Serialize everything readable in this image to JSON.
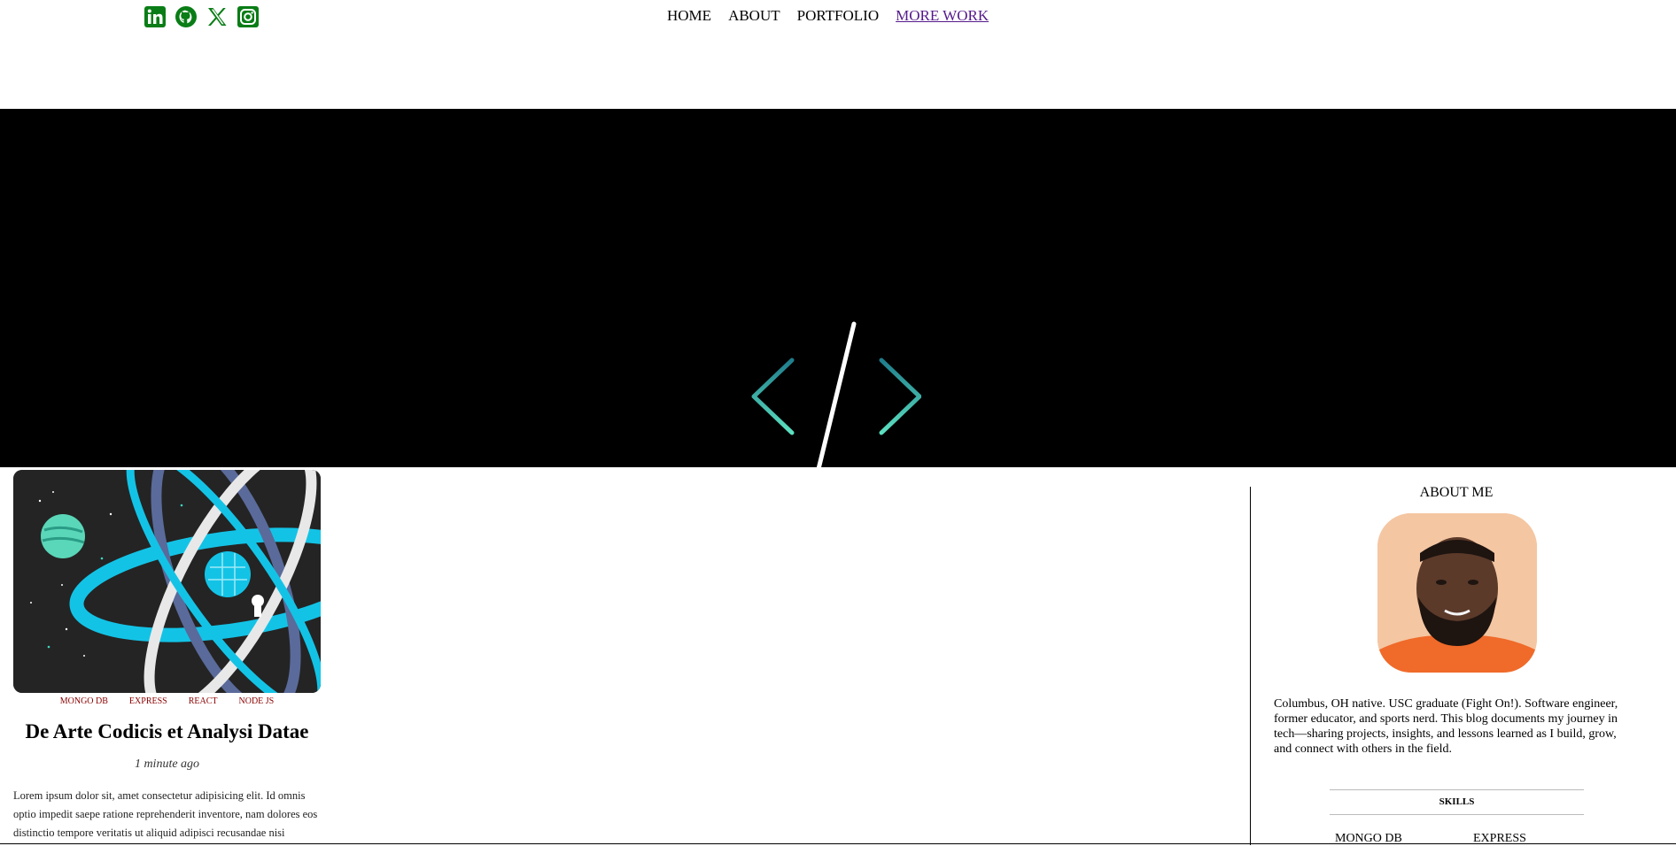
{
  "social": {
    "icons": [
      "linkedin-icon",
      "github-icon",
      "x-icon",
      "instagram-icon"
    ],
    "color": "#0a7d16"
  },
  "nav": {
    "items": [
      "HOME",
      "ABOUT",
      "PORTFOLIO",
      "MORE WORK"
    ]
  },
  "hero": {
    "icon": "code-slash-icon",
    "background": "#000000",
    "accent": "#3fc1a9"
  },
  "post": {
    "tags": [
      "MONGO DB",
      "EXPRESS",
      "REACT",
      "NODE JS"
    ],
    "title": "De Arte Codicis et Analysi Datae",
    "time": "1 minute ago",
    "excerpt": "Lorem ipsum dolor sit, amet consectetur adipisicing elit. Id omnis optio impedit saepe ratione reprehenderit inventore, nam dolores eos distinctio tempore veritatis ut aliquid adipisci recusandae nisi"
  },
  "sidebar": {
    "about_title": "ABOUT ME",
    "bio": "Columbus, OH native. USC graduate (Fight On!). Software engineer, former educator, and sports nerd. This blog documents my journey in tech—sharing projects, insights, and lessons learned as I build, grow, and connect with others in the field.",
    "skills_title": "SKILLS",
    "skills": [
      "MONGO DB",
      "EXPRESS"
    ]
  }
}
